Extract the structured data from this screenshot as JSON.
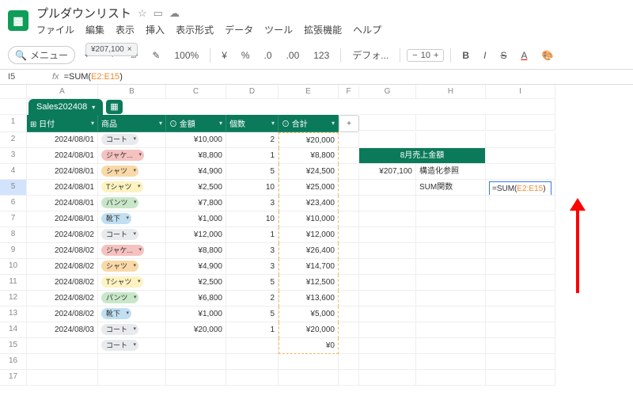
{
  "doc": {
    "title": "プルダウンリスト"
  },
  "menu": [
    "ファイル",
    "編集",
    "表示",
    "挿入",
    "表示形式",
    "データ",
    "ツール",
    "拡張機能",
    "ヘルプ"
  ],
  "toolbar": {
    "search": "メニュー",
    "zoom": "100%",
    "currency": "¥",
    "percent": "%",
    "dec1": ".0",
    "dec2": ".00",
    "num": "123",
    "font": "デフォ...",
    "size": "10",
    "tooltip": "¥207,100"
  },
  "fx": {
    "cell": "I5",
    "prefix": "=SUM(",
    "ref": "E2:E15",
    "suffix": ")"
  },
  "cols": [
    "A",
    "B",
    "C",
    "D",
    "E",
    "F",
    "G",
    "H",
    "I"
  ],
  "tab": {
    "name": "Sales202408"
  },
  "headers": {
    "date": "日付",
    "product": "商品",
    "amount": "金額",
    "qty": "個数",
    "total": "合計"
  },
  "chipLabels": {
    "coat": "コート",
    "jacket": "ジャケ...",
    "shirt": "シャツ",
    "tshirt": "Tシャツ",
    "pants": "パンツ",
    "socks": "靴下"
  },
  "rows": [
    {
      "n": 2,
      "date": "2024/08/01",
      "p": "coat",
      "amt": "¥10,000",
      "qty": "2",
      "tot": "¥20,000"
    },
    {
      "n": 3,
      "date": "2024/08/01",
      "p": "jacket",
      "amt": "¥8,800",
      "qty": "1",
      "tot": "¥8,800"
    },
    {
      "n": 4,
      "date": "2024/08/01",
      "p": "shirt",
      "amt": "¥4,900",
      "qty": "5",
      "tot": "¥24,500"
    },
    {
      "n": 5,
      "date": "2024/08/01",
      "p": "tshirt",
      "amt": "¥2,500",
      "qty": "10",
      "tot": "¥25,000"
    },
    {
      "n": 6,
      "date": "2024/08/01",
      "p": "pants",
      "amt": "¥7,800",
      "qty": "3",
      "tot": "¥23,400"
    },
    {
      "n": 7,
      "date": "2024/08/01",
      "p": "socks",
      "amt": "¥1,000",
      "qty": "10",
      "tot": "¥10,000"
    },
    {
      "n": 8,
      "date": "2024/08/02",
      "p": "coat",
      "amt": "¥12,000",
      "qty": "1",
      "tot": "¥12,000"
    },
    {
      "n": 9,
      "date": "2024/08/02",
      "p": "jacket",
      "amt": "¥8,800",
      "qty": "3",
      "tot": "¥26,400"
    },
    {
      "n": 10,
      "date": "2024/08/02",
      "p": "shirt",
      "amt": "¥4,900",
      "qty": "3",
      "tot": "¥14,700"
    },
    {
      "n": 11,
      "date": "2024/08/02",
      "p": "tshirt",
      "amt": "¥2,500",
      "qty": "5",
      "tot": "¥12,500"
    },
    {
      "n": 12,
      "date": "2024/08/02",
      "p": "pants",
      "amt": "¥6,800",
      "qty": "2",
      "tot": "¥13,600"
    },
    {
      "n": 13,
      "date": "2024/08/02",
      "p": "socks",
      "amt": "¥1,000",
      "qty": "5",
      "tot": "¥5,000"
    },
    {
      "n": 14,
      "date": "2024/08/03",
      "p": "coat",
      "amt": "¥20,000",
      "qty": "1",
      "tot": "¥20,000"
    },
    {
      "n": 15,
      "date": "",
      "p": "coat",
      "amt": "",
      "qty": "",
      "tot": "¥0"
    }
  ],
  "side": {
    "title": "8月売上金額",
    "val": "¥207,100",
    "lbl1": "構造化参照",
    "lbl2": "SUM関数",
    "formula_prefix": "=SUM(",
    "formula_ref": "E2:E15",
    "formula_suffix": ")"
  }
}
